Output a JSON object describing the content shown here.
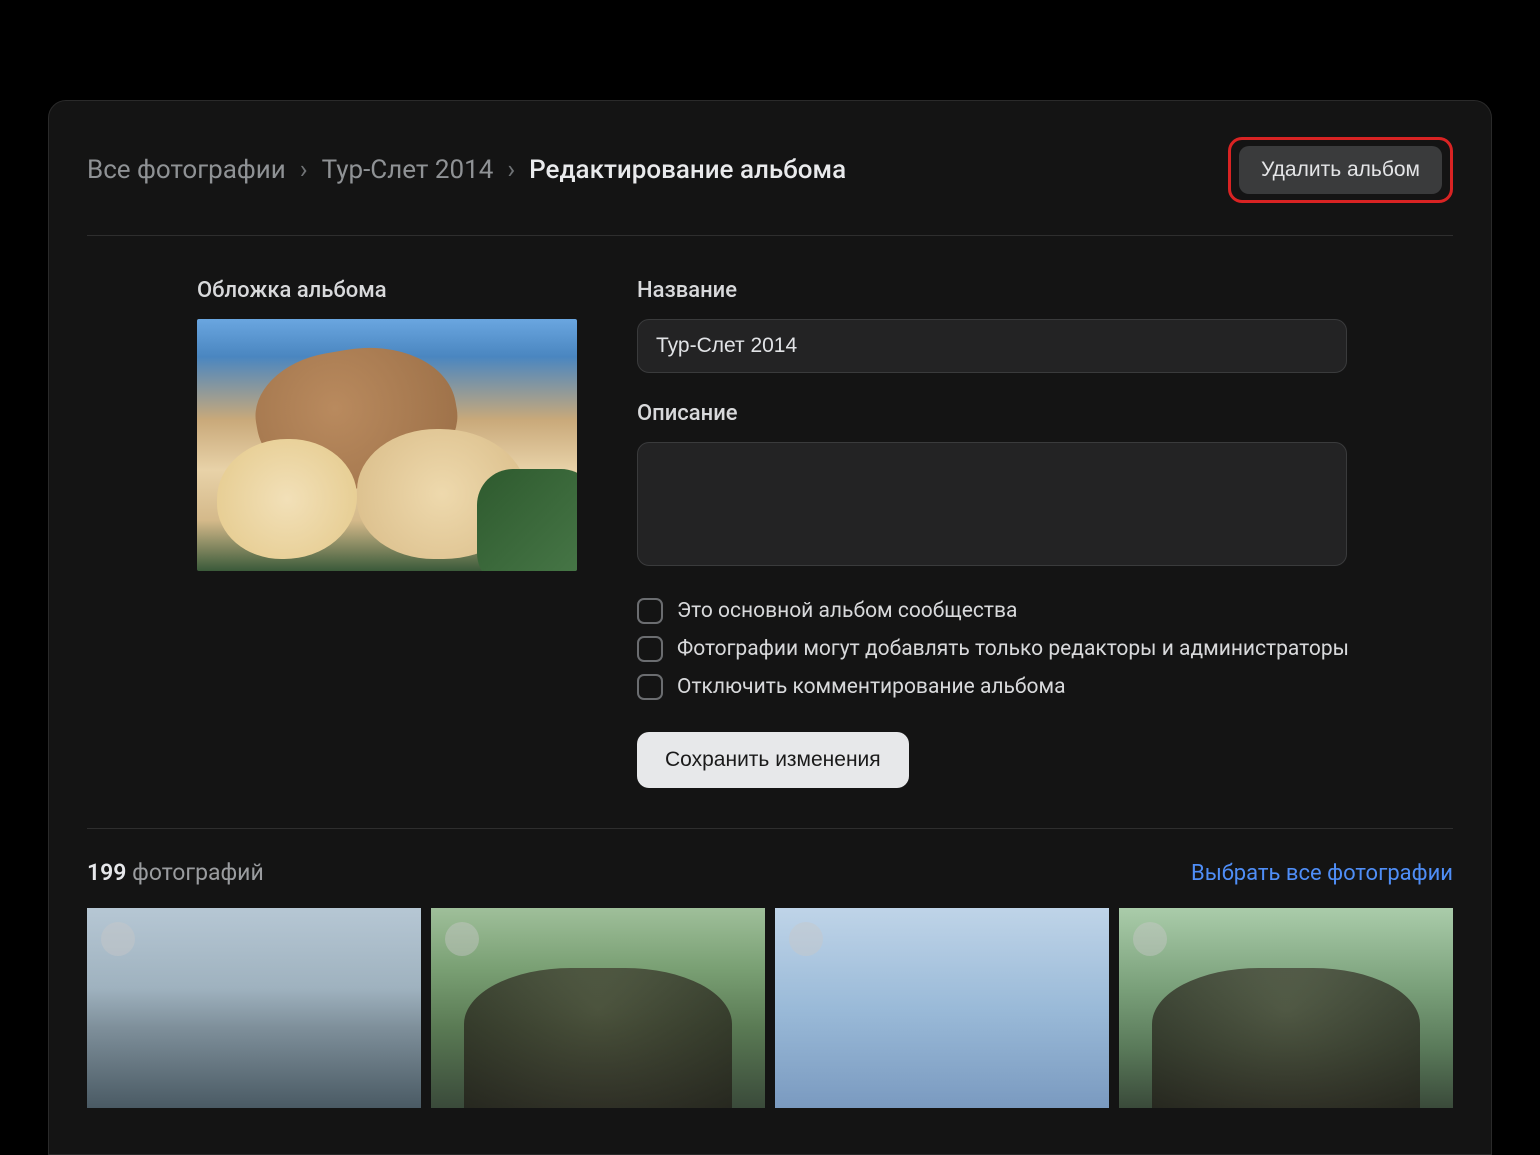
{
  "breadcrumb": {
    "root": "Все фотографии",
    "album": "Тур-Слет 2014",
    "current": "Редактирование альбома"
  },
  "delete_button": "Удалить альбом",
  "cover_label": "Обложка альбома",
  "form": {
    "title_label": "Название",
    "title_value": "Тур-Слет 2014",
    "desc_label": "Описание",
    "desc_value": ""
  },
  "checks": {
    "main_album": "Это основной альбом сообщества",
    "editors_only": "Фотографии могут добавлять только редакторы и администраторы",
    "disable_comments": "Отключить комментирование альбома"
  },
  "save_button": "Сохранить изменения",
  "footer": {
    "count": "199",
    "count_suffix": "фотографий",
    "select_all": "Выбрать все фотографии"
  }
}
